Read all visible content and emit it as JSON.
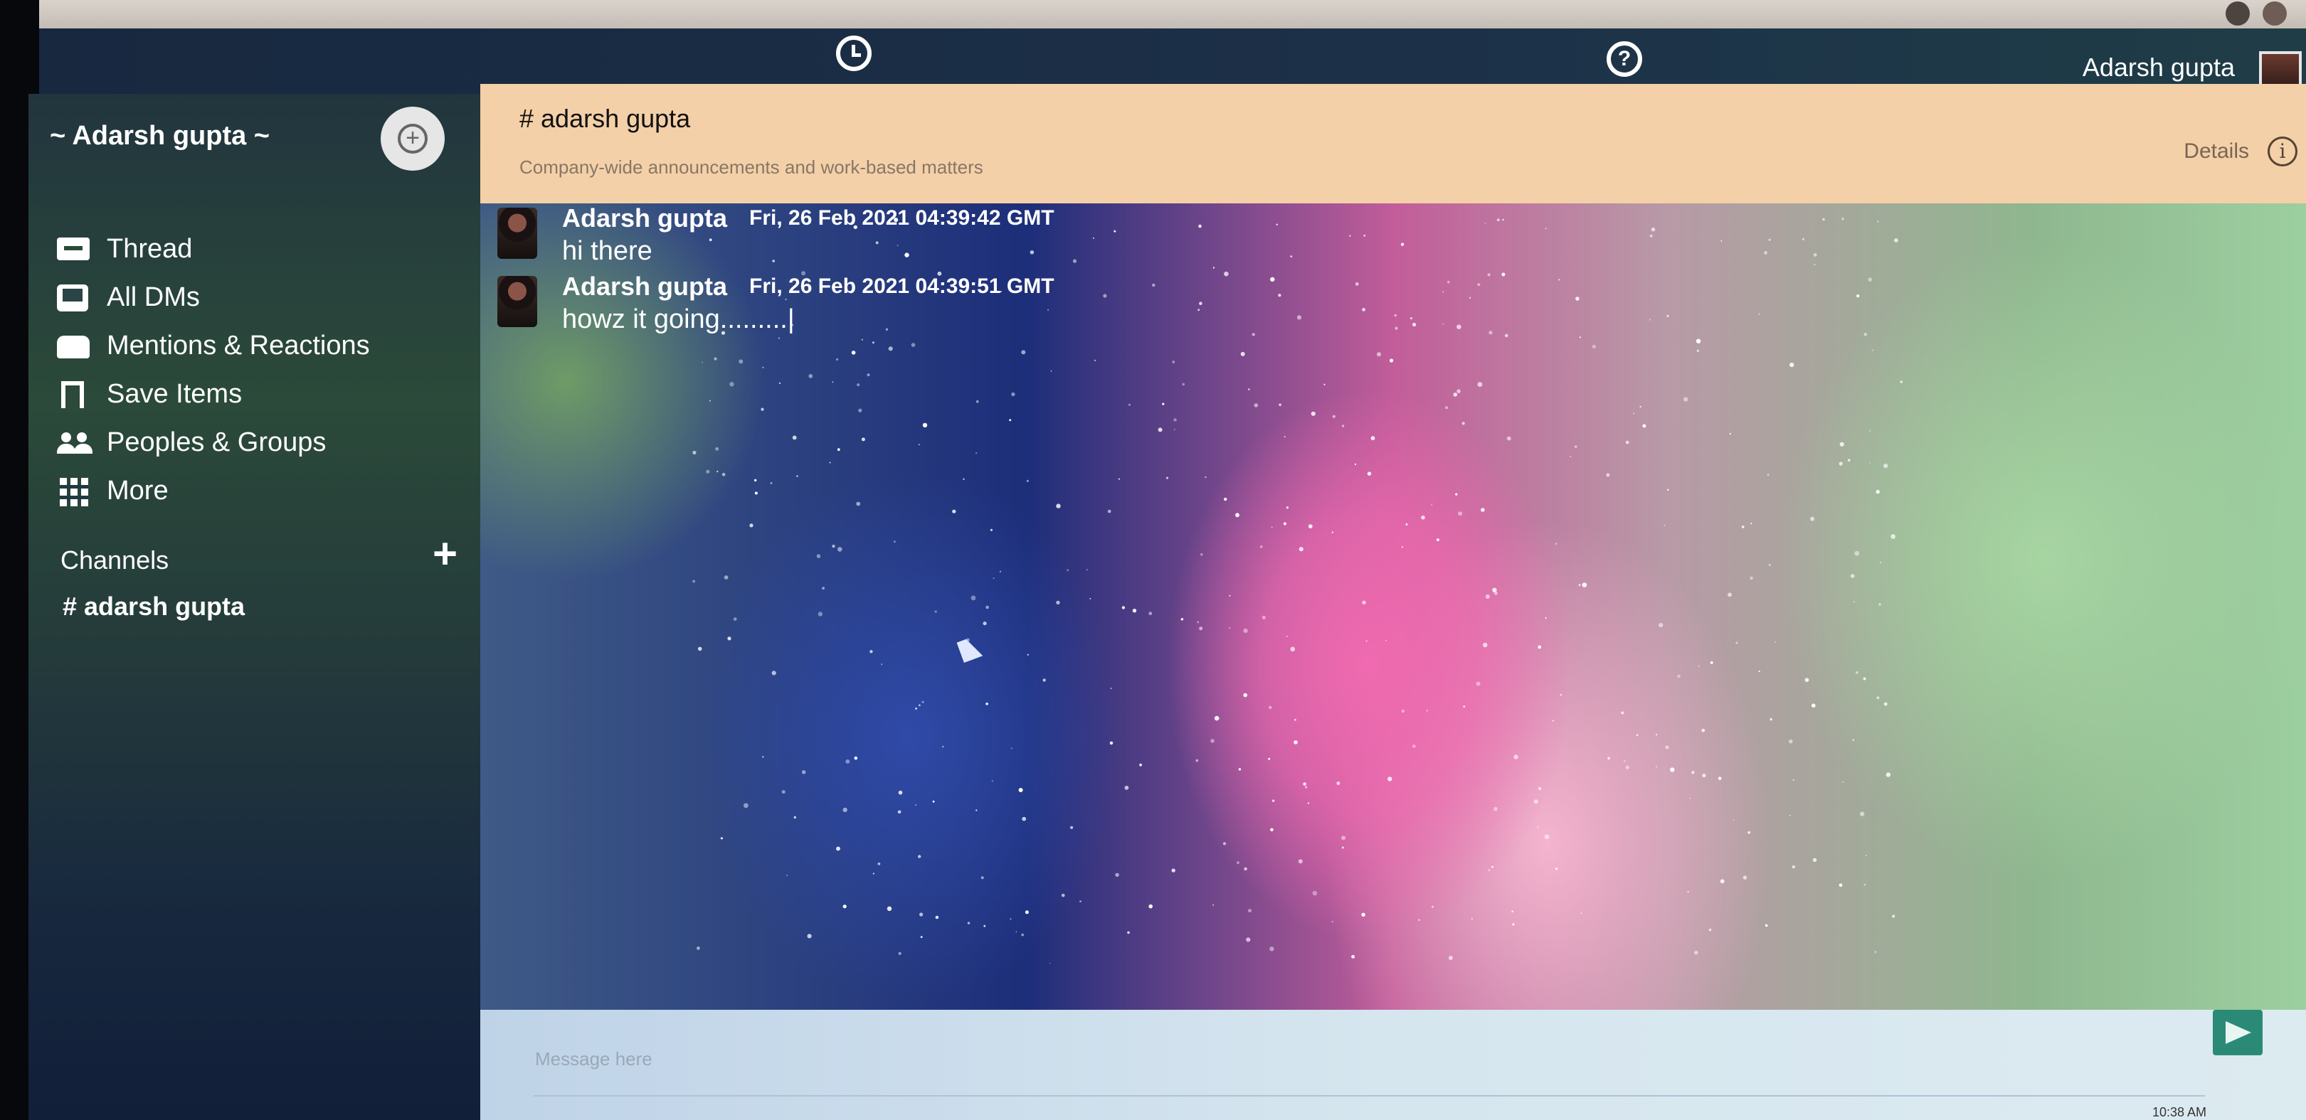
{
  "app": {
    "user_name": "Adarsh gupta",
    "workspace_name": "~ Adarsh gupta ~"
  },
  "topbar": {
    "icons": [
      "clock-icon",
      "help-icon"
    ]
  },
  "sidebar": {
    "items": [
      {
        "label": "Thread",
        "icon": "message-icon"
      },
      {
        "label": "All DMs",
        "icon": "inbox-icon"
      },
      {
        "label": "Mentions & Reactions",
        "icon": "envelope-icon"
      },
      {
        "label": "Save Items",
        "icon": "bookmark-icon"
      },
      {
        "label": "Peoples & Groups",
        "icon": "people-icon"
      },
      {
        "label": "More",
        "icon": "grid-icon"
      }
    ],
    "channels_heading": "Channels",
    "add_channel": "+",
    "channels": [
      "# adarsh gupta"
    ]
  },
  "channel": {
    "title": "# adarsh gupta",
    "description": "Company-wide announcements and work-based matters",
    "details_label": "Details",
    "info_glyph": "i"
  },
  "messages": [
    {
      "author": "Adarsh gupta",
      "time": "Fri, 26 Feb 2021 04:39:42 GMT",
      "text": "hi there"
    },
    {
      "author": "Adarsh gupta",
      "time": "Fri, 26 Feb 2021 04:39:51 GMT",
      "text": "howz it going.........|"
    }
  ],
  "composer": {
    "placeholder": "Message here",
    "value": ""
  },
  "system": {
    "clock": "10:38 AM"
  },
  "colors": {
    "header_bg": "#f4d0a8",
    "send_button": "#2a8a76",
    "appbar": "#1c3048"
  }
}
